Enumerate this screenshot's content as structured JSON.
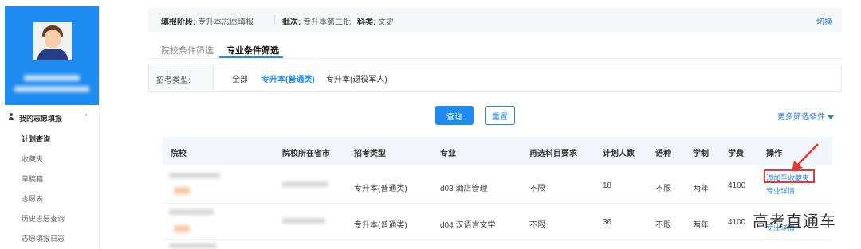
{
  "sidebar": {
    "menu_title": "我的志愿填报",
    "items": [
      "计划查询",
      "收藏夹",
      "草稿箱",
      "志愿表",
      "历史志愿查询",
      "志愿填报日志"
    ]
  },
  "infobar": {
    "stage_label": "填报阶段:",
    "stage_value": "专升本志愿填报",
    "batch_label": "批次:",
    "batch_value": "专升本第二批",
    "subject_label": "科类:",
    "subject_value": "文史",
    "switch": "切换"
  },
  "tabs": [
    "院校条件筛选",
    "专业条件筛选"
  ],
  "filter": {
    "label": "招考类型:",
    "options": [
      "全部",
      "专升本(普通类)",
      "专升本(退役军人)"
    ]
  },
  "actions": {
    "query": "查询",
    "reset": "重置",
    "more": "更多筛选条件"
  },
  "table": {
    "headers": [
      "院校",
      "院校所在省市",
      "招考类型",
      "专业",
      "再选科目要求",
      "计划人数",
      "语种",
      "学制",
      "学费",
      "操作"
    ],
    "rows": [
      {
        "type": "专升本(普通类)",
        "major": "d03 酒店管理",
        "req": "不限",
        "plan": "18",
        "lang": "不限",
        "years": "两年",
        "fee": "4100",
        "op1": "添加至收藏夹",
        "op2": "专业详情"
      },
      {
        "type": "专升本(普通类)",
        "major": "d04 汉语言文学",
        "req": "不限",
        "plan": "36",
        "lang": "不限",
        "years": "两年",
        "fee": "4100",
        "op1": "添加至收藏夹",
        "op2": "专业详情"
      }
    ]
  },
  "watermark": "高考直通车",
  "colors": {
    "accent": "#1e8bf0",
    "highlight": "#e53935"
  }
}
